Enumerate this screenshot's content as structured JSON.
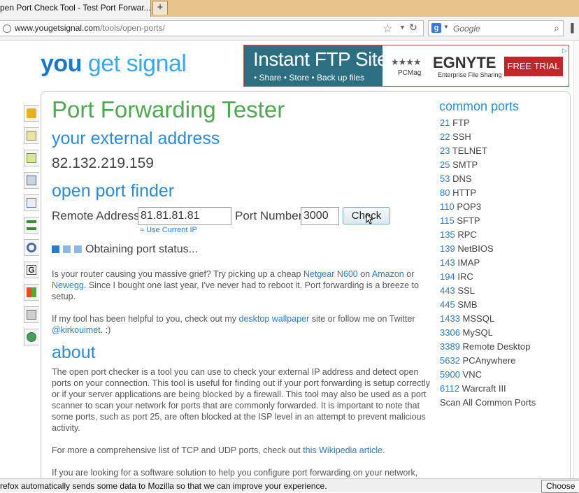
{
  "browser": {
    "tab_title": "pen Port Check Tool - Test Port Forwar...",
    "new_tab": "+",
    "url_domain": "www.yougetsignal.com",
    "url_path": "/tools/open-ports/",
    "search_placeholder": "Google",
    "search_engine_letter": "g"
  },
  "site": {
    "logo_you": "you",
    "logo_rest": " get signal"
  },
  "ad": {
    "title": "Instant FTP Site",
    "subtitle": "• Share • Store • Back up files",
    "stars": "★★★★",
    "pcmag": "PCMag",
    "brand": "EGNYTE",
    "brand_sub": "Enterprise File Sharing",
    "cta": "FREE TRIAL"
  },
  "main": {
    "title": "Port Forwarding Tester",
    "external_heading": "your external address",
    "external_ip": "82.132.219.159",
    "finder_heading": "open port finder",
    "remote_label": "Remote Address",
    "remote_value": "81.81.81.81",
    "port_label": "Port Number",
    "port_value": "3000",
    "check_button": "Check",
    "use_current_ip": "Use Current IP",
    "status_text": "Obtaining port status...",
    "para1_a": "Is your router causing you massive grief? Try picking up a cheap ",
    "para1_link1": "Netgear N600",
    "para1_b": " on ",
    "para1_link2": "Amazon",
    "para1_c": " or ",
    "para1_link3": "Newegg",
    "para1_d": ". Since I bought one last year, I've never had to reboot it. Port forwarding is a breeze to setup.",
    "para2_a": "If my tool has been helpful to you, check out my ",
    "para2_link1": "desktop wallpaper",
    "para2_b": " site or follow me on Twitter ",
    "para2_link2": "@kirkouimet",
    "para2_c": ". :)",
    "about_heading": "about",
    "about_text": "The open port checker is a tool you can use to check your external IP address and detect open ports on your connection. This tool is useful for finding out if your port forwarding is setup correctly or if your server applications are being blocked by a firewall. This tool may also be used as a port scanner to scan your network for ports that are commonly forwarded. It is important to note that some ports, such as port 25, are often blocked at the ISP level in an attempt to prevent malicious activity.",
    "para3_a": "For more a comprehensive list of TCP and UDP ports, check out ",
    "para3_link": "this Wikipedia article",
    "para3_b": ".",
    "para4": "If you are looking for a software solution to help you configure port forwarding on your network,"
  },
  "common_ports": {
    "title": "common ports",
    "items": [
      {
        "port": "21",
        "name": "FTP"
      },
      {
        "port": "22",
        "name": "SSH"
      },
      {
        "port": "23",
        "name": "TELNET"
      },
      {
        "port": "25",
        "name": "SMTP"
      },
      {
        "port": "53",
        "name": "DNS"
      },
      {
        "port": "80",
        "name": "HTTP"
      },
      {
        "port": "110",
        "name": "POP3"
      },
      {
        "port": "115",
        "name": "SFTP"
      },
      {
        "port": "135",
        "name": "RPC"
      },
      {
        "port": "139",
        "name": "NetBIOS"
      },
      {
        "port": "143",
        "name": "IMAP"
      },
      {
        "port": "194",
        "name": "IRC"
      },
      {
        "port": "443",
        "name": "SSL"
      },
      {
        "port": "445",
        "name": "SMB"
      },
      {
        "port": "1433",
        "name": "MSSQL"
      },
      {
        "port": "3306",
        "name": "MySQL"
      },
      {
        "port": "3389",
        "name": "Remote Desktop"
      },
      {
        "port": "5632",
        "name": "PCAnywhere"
      },
      {
        "port": "5900",
        "name": "VNC"
      },
      {
        "port": "6112",
        "name": "Warcraft III"
      }
    ],
    "scan_all": "Scan All Common Ports"
  },
  "sidebar_icons": [
    "lock-icon",
    "document-icon",
    "image-icon",
    "server-icon",
    "mail-icon",
    "network-icon",
    "target-icon",
    "google-icon",
    "windows-icon",
    "router-icon",
    "globe-icon"
  ],
  "notification": {
    "text": "refox automatically sends some data to Mozilla so that we can improve your experience.",
    "button": "Choose"
  },
  "colors": {
    "title_green": "#4fa84f",
    "heading_blue": "#2e8bd1",
    "link_blue": "#2e7bc4",
    "tab_strip": "#e6c48a"
  }
}
